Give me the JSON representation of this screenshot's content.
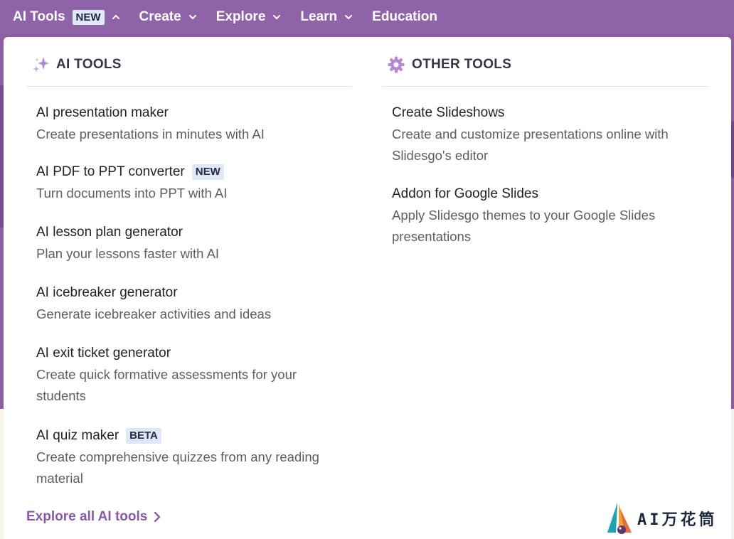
{
  "nav": {
    "items": [
      {
        "label": "AI Tools",
        "badge": "NEW",
        "chevron": "chevron-up-icon"
      },
      {
        "label": "Create",
        "chevron": "chevron-down-icon"
      },
      {
        "label": "Explore",
        "chevron": "chevron-down-icon"
      },
      {
        "label": "Learn",
        "chevron": "chevron-down-icon"
      },
      {
        "label": "Education"
      }
    ]
  },
  "ai_tools": {
    "heading": "AI TOOLS",
    "icon": "sparkles-icon",
    "items": [
      {
        "title": "AI presentation maker",
        "desc": "Create presentations in minutes with AI"
      },
      {
        "title": "AI PDF to PPT converter",
        "tag": "NEW",
        "desc": "Turn documents into PPT with AI"
      },
      {
        "title": "AI lesson plan generator",
        "desc": "Plan your lessons faster with AI"
      },
      {
        "title": "AI icebreaker generator",
        "desc": "Generate icebreaker activities and ideas"
      },
      {
        "title": "AI exit ticket generator",
        "desc": "Create quick formative assessments for your students"
      },
      {
        "title": "AI quiz maker",
        "tag": "BETA",
        "desc": "Create comprehensive quizzes from any reading material"
      }
    ],
    "footer_link": "Explore all AI tools"
  },
  "other_tools": {
    "heading": "OTHER TOOLS",
    "icon": "gear-icon",
    "items": [
      {
        "title": "Create Slideshows",
        "desc": "Create and customize presentations online with Slidesgo's editor"
      },
      {
        "title": "Addon for Google Slides",
        "desc": "Apply Slidesgo themes to your Google Slides presentations"
      }
    ]
  },
  "watermark": {
    "text": "AI万花筒"
  },
  "colors": {
    "nav_bg": "#8f63a8",
    "badge_bg": "#dfe8f7",
    "accent": "#8a5aa6",
    "icon_purple": "#b389d1"
  }
}
